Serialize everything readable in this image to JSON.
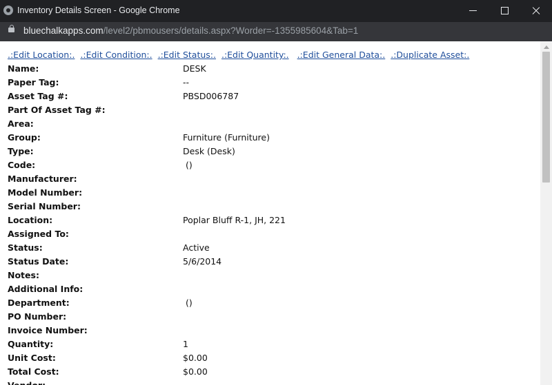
{
  "window": {
    "title": "Inventory Details Screen - Google Chrome"
  },
  "address": {
    "host": "bluechalkapps.com",
    "path": "/level2/pbmousers/details.aspx?Worder=-1355985604&Tab=1"
  },
  "actions": [
    ".:Edit Location:.",
    ".:Edit Condition:.",
    ".:Edit Status:.",
    ".:Edit Quantity:.",
    ".:Edit General Data:.",
    ".:Duplicate Asset:."
  ],
  "fields": [
    {
      "label": "Name:",
      "value": "DESK"
    },
    {
      "label": "Paper Tag:",
      "value": "--"
    },
    {
      "label": "Asset Tag #:",
      "value": "PBSD006787"
    },
    {
      "label": "Part Of Asset Tag #:",
      "value": ""
    },
    {
      "label": "Area:",
      "value": ""
    },
    {
      "label": "Group:",
      "value": "Furniture (Furniture)"
    },
    {
      "label": "Type:",
      "value": "Desk (Desk)"
    },
    {
      "label": "Code:",
      "value": " ()"
    },
    {
      "label": "Manufacturer:",
      "value": ""
    },
    {
      "label": "Model Number:",
      "value": ""
    },
    {
      "label": "Serial Number:",
      "value": ""
    },
    {
      "label": "Location:",
      "value": "Poplar Bluff R-1, JH, 221"
    },
    {
      "label": "Assigned To:",
      "value": ""
    },
    {
      "label": "Status:",
      "value": "Active"
    },
    {
      "label": "Status Date:",
      "value": "5/6/2014"
    },
    {
      "label": "Notes:",
      "value": ""
    },
    {
      "label": "Additional Info:",
      "value": ""
    },
    {
      "label": "Department:",
      "value": " ()"
    },
    {
      "label": "PO Number:",
      "value": ""
    },
    {
      "label": "Invoice Number:",
      "value": ""
    },
    {
      "label": "Quantity:",
      "value": "1"
    },
    {
      "label": "Unit Cost:",
      "value": "$0.00"
    },
    {
      "label": "Total Cost:",
      "value": "$0.00"
    },
    {
      "label": "Vendor:",
      "value": ""
    }
  ]
}
